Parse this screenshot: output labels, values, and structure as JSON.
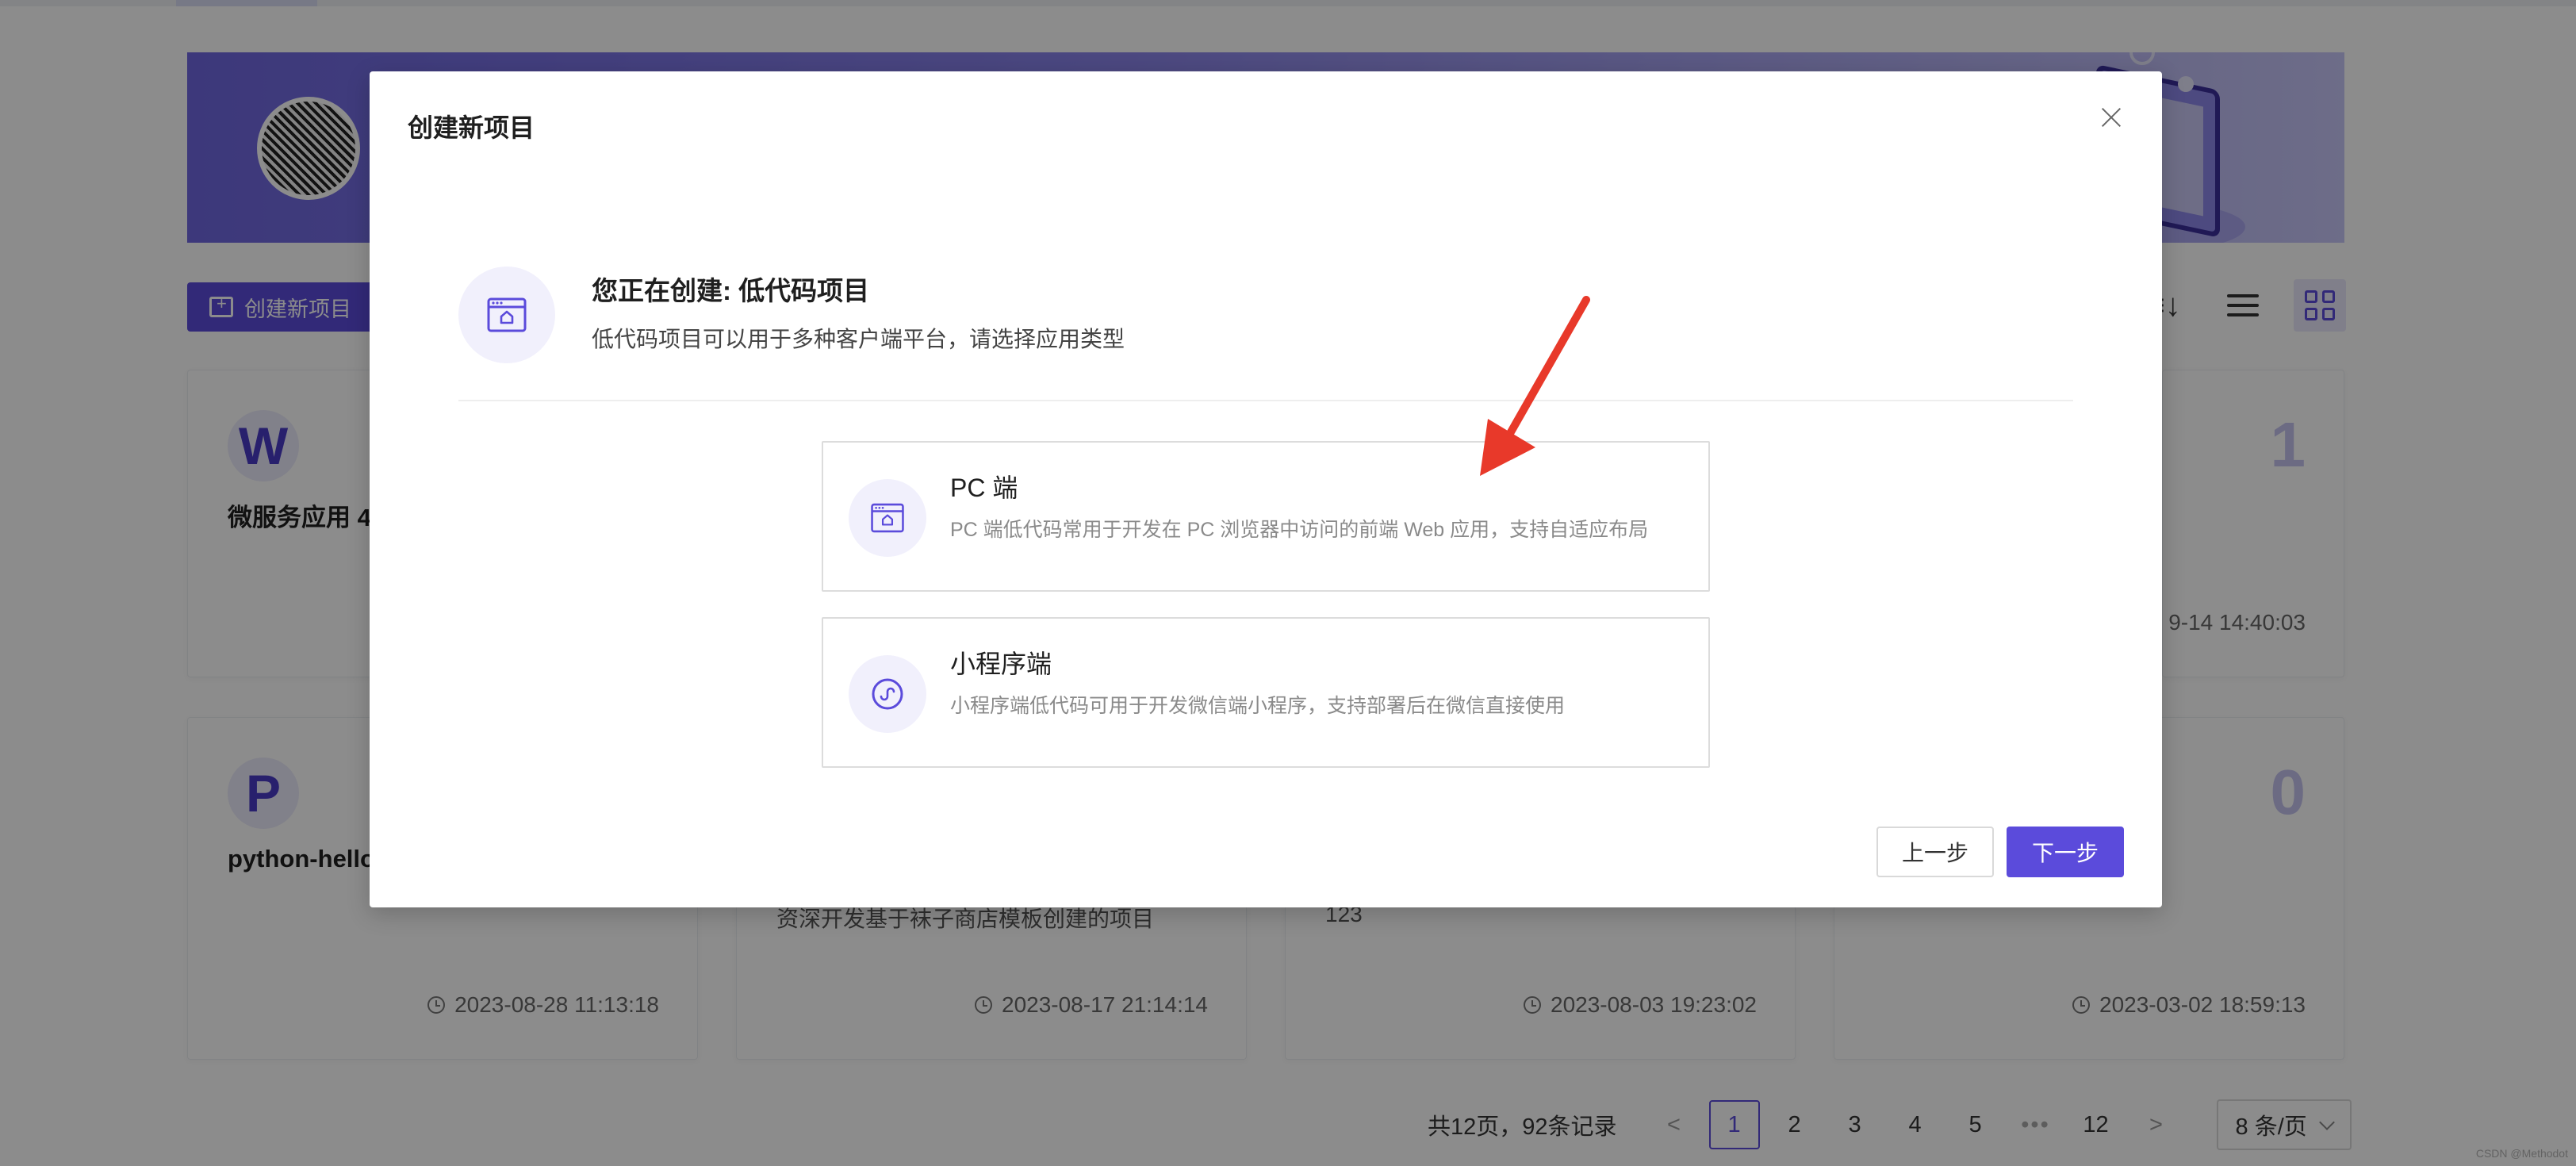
{
  "background": {
    "create_button_label": "创建新项目",
    "sort_icon_text": "≡↓",
    "cards": [
      {
        "letter": "W",
        "name": "微服务应用 4",
        "desc": "",
        "date": "",
        "count": ""
      },
      {
        "letter": "",
        "name": "",
        "desc": "",
        "date": "9-14 14:40:03",
        "count": "1"
      },
      {
        "letter": "P",
        "name": "python-hello",
        "desc": "",
        "date": "2023-08-28 11:13:18",
        "count": ""
      },
      {
        "letter": "",
        "name": "",
        "desc": "资深开发基于袜子商店模板创建的项目",
        "date": "2023-08-17 21:14:14",
        "count": ""
      },
      {
        "letter": "",
        "name": "",
        "desc": "123",
        "date": "2023-08-03 19:23:02",
        "count": ""
      },
      {
        "letter": "",
        "name": "",
        "desc": "",
        "date": "2023-03-02 18:59:13",
        "count": "0"
      }
    ],
    "pagination": {
      "total": "共12页，92条记录",
      "prev": "<",
      "pages": [
        "1",
        "2",
        "3",
        "4",
        "5"
      ],
      "ellipsis": "•••",
      "last": "12",
      "next": ">",
      "page_size": "8 条/页"
    },
    "watermark": "CSDN @Methodot"
  },
  "modal": {
    "title": "创建新项目",
    "intro_title": "您正在创建: 低代码项目",
    "intro_desc": "低代码项目可以用于多种客户端平台，请选择应用类型",
    "options": [
      {
        "icon": "browser-window-icon",
        "title": "PC 端",
        "desc": "PC 端低代码常用于开发在 PC 浏览器中访问的前端 Web 应用，支持自适应布局"
      },
      {
        "icon": "mini-program-icon",
        "title": "小程序端",
        "desc": "小程序端低代码可用于开发微信端小程序，支持部署后在微信直接使用"
      }
    ],
    "prev_label": "上一步",
    "next_label": "下一步"
  },
  "colors": {
    "accent": "#5b4bdb",
    "annotation_arrow": "#e8392a"
  }
}
